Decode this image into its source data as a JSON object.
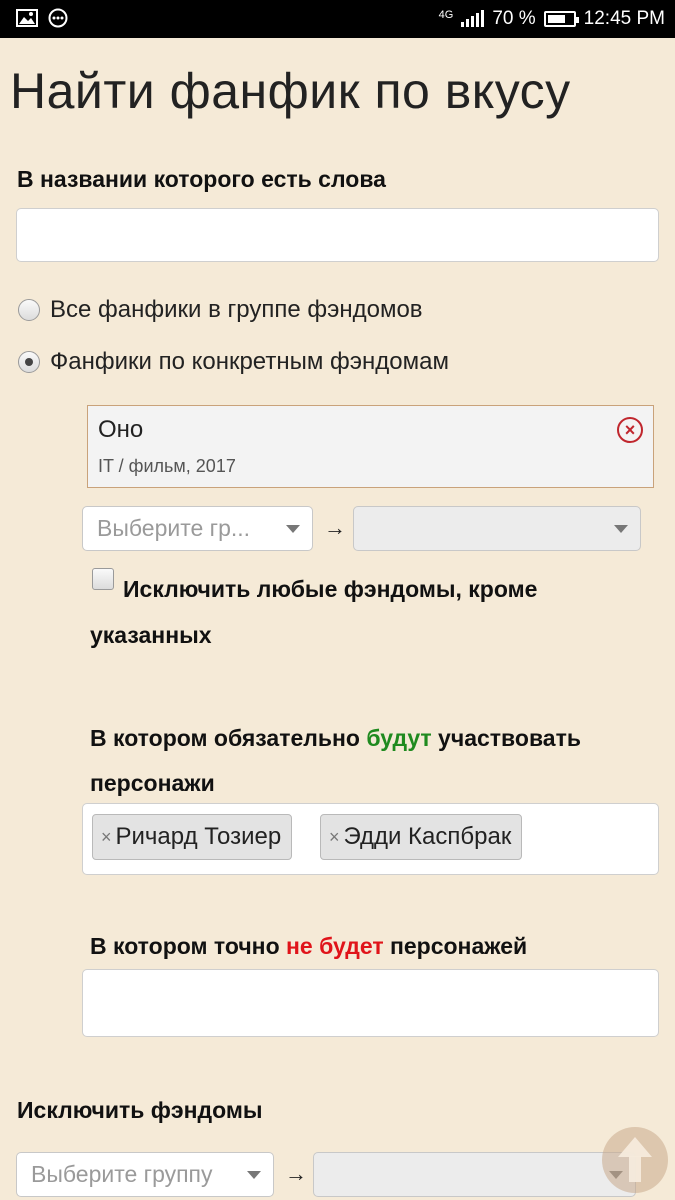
{
  "status_bar": {
    "network": "4G",
    "battery_text": "70 %",
    "battery_level": 0.7,
    "time": "12:45 PM",
    "icons": [
      "image-icon",
      "more-icon",
      "signal-icon",
      "battery-icon"
    ]
  },
  "page": {
    "title": "Найти фанфик по вкусу"
  },
  "title_words": {
    "label": "В названии которого есть слова",
    "value": ""
  },
  "fandom_scope": {
    "options": [
      {
        "label": "Все фанфики в группе фэндомов",
        "checked": false
      },
      {
        "label": "Фанфики по конкретным фэндомам",
        "checked": true
      }
    ]
  },
  "selected_fandom": {
    "name": "Оно",
    "details": "IT / фильм, 2017"
  },
  "fandom_select": {
    "group_placeholder": "Выберите гр...",
    "arrow": "→",
    "fandom_value": ""
  },
  "exclude_other": {
    "label": "Исключить любые фэндомы, кроме указанных",
    "checked": false
  },
  "characters_include": {
    "label_before": "В котором обязательно ",
    "label_highlight": "будут",
    "label_after": " участвовать персонажи",
    "highlight_color": "#1f8a1f",
    "tags": [
      "Ричард Тозиер",
      "Эдди Каспбрак"
    ],
    "tag_remove_glyph": "×"
  },
  "characters_exclude": {
    "label_before": "В котором точно ",
    "label_highlight": "не будет",
    "label_after": " персонажей",
    "highlight_color": "#e0141a",
    "value": ""
  },
  "exclude_fandoms": {
    "label": "Исключить фэндомы",
    "group_placeholder": "Выберите группу",
    "arrow": "→",
    "fandom_value": ""
  }
}
